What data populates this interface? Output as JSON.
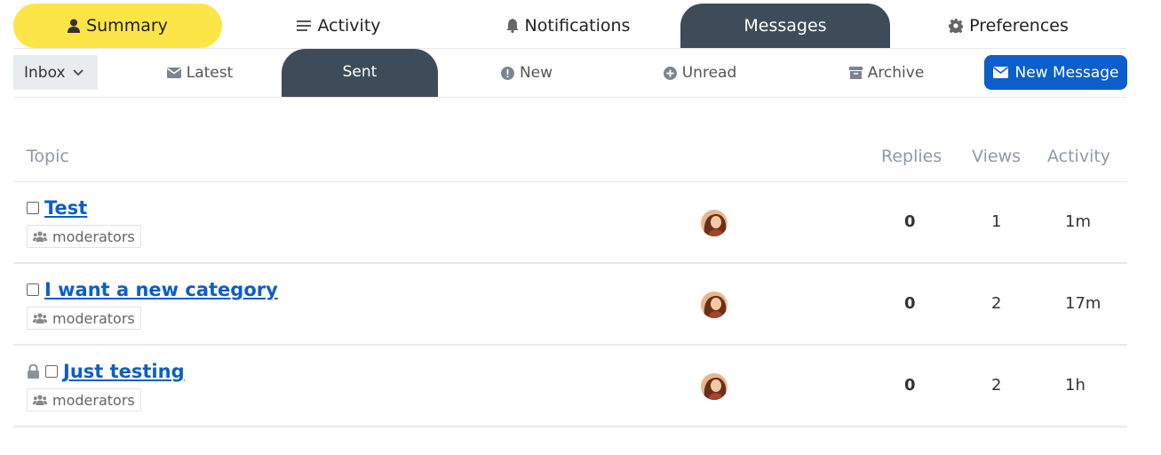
{
  "top_nav": {
    "tabs": [
      {
        "label": "Summary",
        "icon": "user-icon"
      },
      {
        "label": "Activity",
        "icon": "list-icon"
      },
      {
        "label": "Notifications",
        "icon": "bell-icon"
      },
      {
        "label": "Messages",
        "icon": ""
      },
      {
        "label": "Preferences",
        "icon": "gear-icon"
      }
    ],
    "active": "Messages"
  },
  "sub_nav": {
    "inbox_label": "Inbox",
    "items": [
      {
        "label": "Latest",
        "icon": "envelope-icon"
      },
      {
        "label": "Sent",
        "icon": ""
      },
      {
        "label": "New",
        "icon": "exclamation-circle-icon"
      },
      {
        "label": "Unread",
        "icon": "plus-circle-icon"
      },
      {
        "label": "Archive",
        "icon": "archive-icon"
      }
    ],
    "active": "Sent",
    "new_message_label": "New Message"
  },
  "table": {
    "headers": {
      "topic": "Topic",
      "replies": "Replies",
      "views": "Views",
      "activity": "Activity"
    },
    "rows": [
      {
        "title": "Test",
        "tag": "moderators",
        "replies": "0",
        "views": "1",
        "activity": "1m",
        "locked": false
      },
      {
        "title": "I want a new category",
        "tag": "moderators",
        "replies": "0",
        "views": "2",
        "activity": "17m",
        "locked": false
      },
      {
        "title": "Just testing",
        "tag": "moderators",
        "replies": "0",
        "views": "2",
        "activity": "1h",
        "locked": true
      }
    ]
  },
  "colors": {
    "summary_tab": "#fbe547",
    "active_dark": "#3e4c5a",
    "primary_button": "#0b5ecc",
    "link": "#0b5ecc",
    "header_text": "#8f9aa6"
  }
}
